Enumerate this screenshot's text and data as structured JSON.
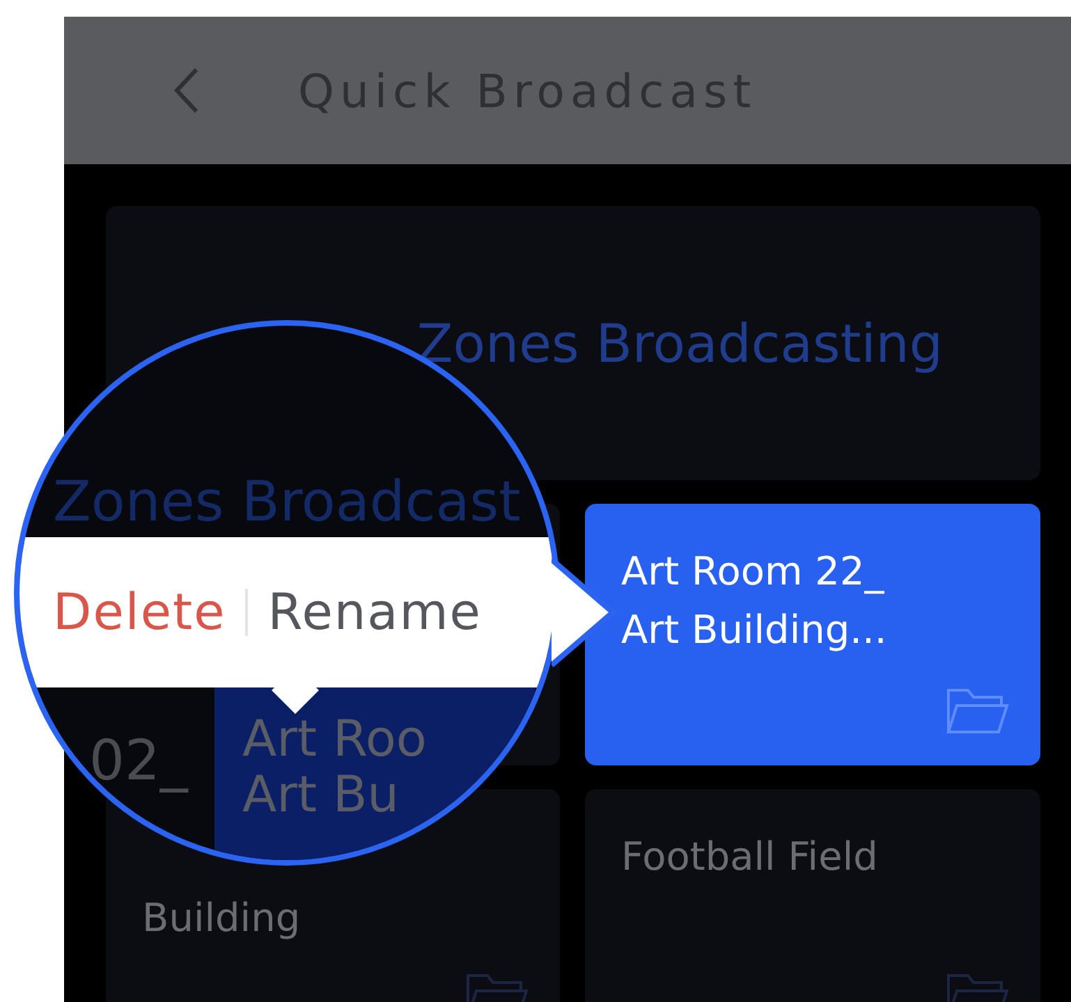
{
  "header": {
    "title": "Quick Broadcast"
  },
  "broadcast_card": {
    "label": "Zones Broadcasting"
  },
  "zones": [
    {
      "kind": "covered",
      "selected": false
    },
    {
      "kind": "normal",
      "name": "Art Room 22_\nArt Building...",
      "selected": true
    },
    {
      "kind": "lower",
      "name": "Building",
      "selected": false
    },
    {
      "kind": "normal",
      "name": "Football Field",
      "selected": false
    }
  ],
  "magnifier": {
    "background_label": "Zones Broadcast",
    "side_label": "02_",
    "card_lines": [
      "Art Roo",
      "Art Bu"
    ],
    "menu": [
      {
        "label": "Delete",
        "kind": "danger"
      },
      {
        "label": "Rename",
        "kind": "normal"
      }
    ]
  }
}
